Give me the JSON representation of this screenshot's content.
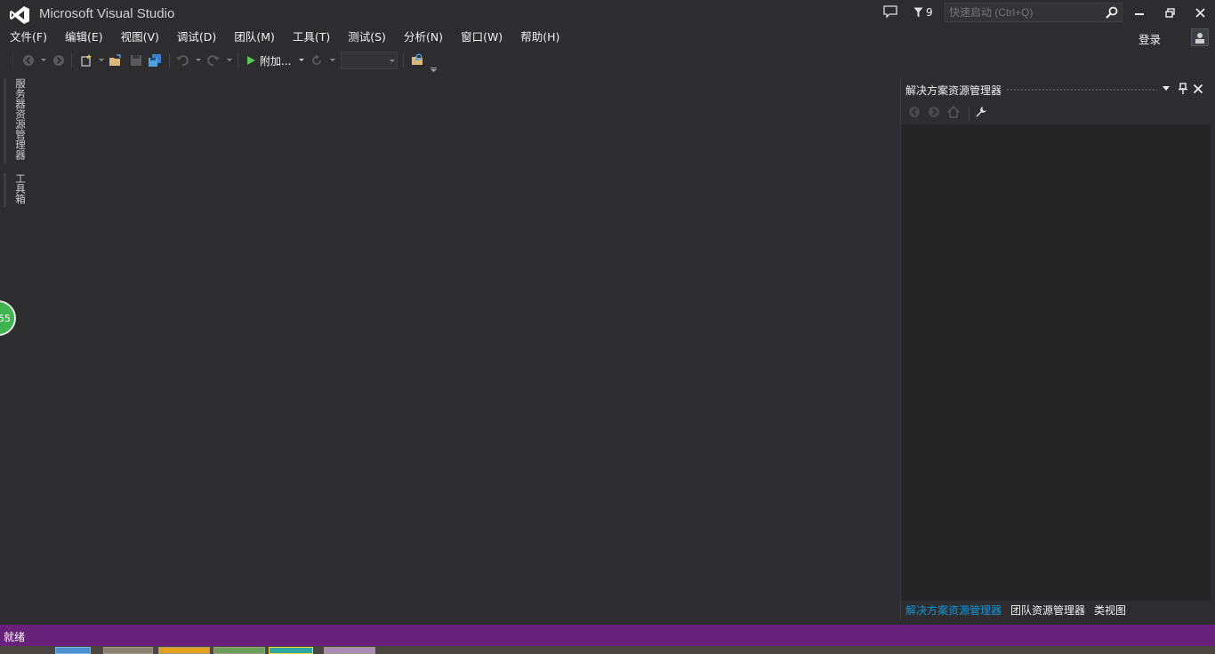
{
  "window": {
    "title": "Microsoft Visual Studio"
  },
  "titlebar": {
    "notification_count": "9",
    "quick_launch_placeholder": "快速启动 (Ctrl+Q)",
    "signin_label": "登录"
  },
  "menu": {
    "items": [
      "文件(F)",
      "编辑(E)",
      "视图(V)",
      "调试(D)",
      "团队(M)",
      "工具(T)",
      "测试(S)",
      "分析(N)",
      "窗口(W)",
      "帮助(H)"
    ]
  },
  "toolbar": {
    "attach_label": "附加..."
  },
  "left_tabs": {
    "server_explorer": "服务器资源管理器",
    "toolbox": "工具箱"
  },
  "badge": {
    "value": "55"
  },
  "solution_explorer": {
    "title": "解决方案资源管理器",
    "tabs": [
      "解决方案资源管理器",
      "团队资源管理器",
      "类视图"
    ]
  },
  "status": {
    "text": "就绪"
  },
  "colors": {
    "accent": "#68217a",
    "active_tab": "#0e97d8",
    "badge": "#3fb34f"
  }
}
